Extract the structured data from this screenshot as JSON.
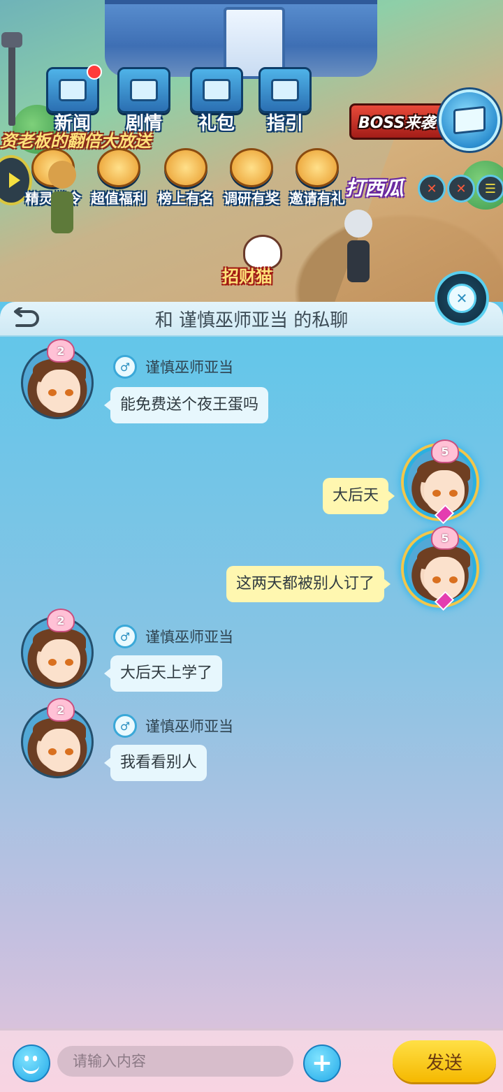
{
  "game": {
    "top_icons": [
      {
        "label": "新闻",
        "icon": "newspaper-icon"
      },
      {
        "label": "剧情",
        "icon": "story-icon"
      },
      {
        "label": "礼包",
        "icon": "gift-pack-icon"
      },
      {
        "label": "指引",
        "icon": "guide-icon"
      }
    ],
    "promo_text": "资老板的翻倍大放送",
    "boss_banner": "BOSS来袭",
    "row_icons": [
      {
        "label": "精灵战令",
        "icon": "battle-pass-icon"
      },
      {
        "label": "超值福利",
        "icon": "welfare-icon"
      },
      {
        "label": "榜上有名",
        "icon": "trophy-icon"
      },
      {
        "label": "调研有奖",
        "icon": "survey-chest-icon"
      },
      {
        "label": "邀请有礼",
        "icon": "invite-gift-icon"
      }
    ],
    "melon_text": "打西瓜",
    "lucky_cat_label": "招财猫"
  },
  "chat": {
    "title": "和 谨慎巫师亚当 的私聊",
    "messages": [
      {
        "side": "left",
        "sender": "谨慎巫师亚当",
        "level": "2",
        "text": "能免费送个夜王蛋吗"
      },
      {
        "side": "right",
        "level": "5",
        "text": "大后天"
      },
      {
        "side": "right",
        "level": "5",
        "text": "这两天都被别人订了"
      },
      {
        "side": "left",
        "sender": "谨慎巫师亚当",
        "level": "2",
        "text": "大后天上学了"
      },
      {
        "side": "left",
        "sender": "谨慎巫师亚当",
        "level": "2",
        "text": "我看看别人"
      }
    ]
  },
  "input": {
    "placeholder": "请输入内容",
    "plus_label": "+",
    "send_label": "发送"
  },
  "colors": {
    "left_bubble": "#e7f7fd",
    "right_bubble": "#fff7b0",
    "send_button": "#f5b800",
    "panel_top": "#5fc6ea"
  }
}
